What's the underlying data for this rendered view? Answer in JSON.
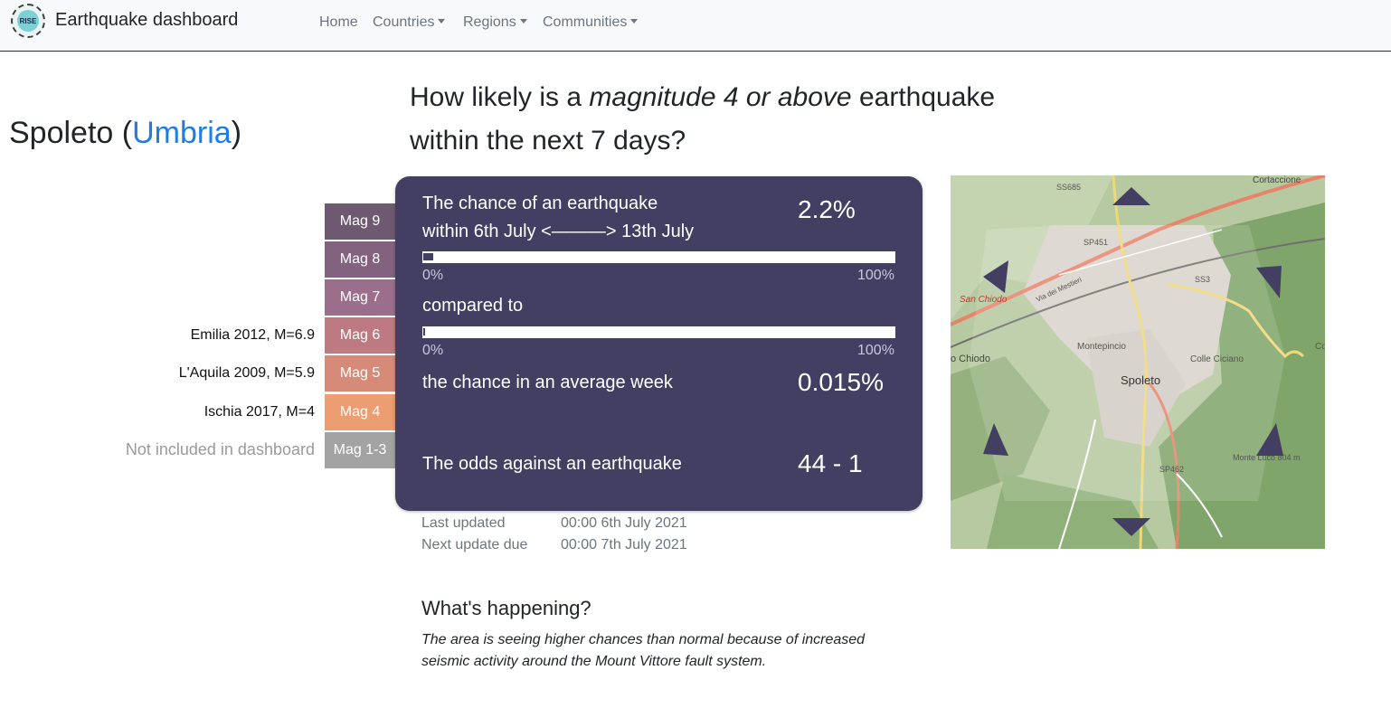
{
  "nav": {
    "logo_text": "RISE",
    "brand": "Earthquake dashboard",
    "items": [
      {
        "label": "Home",
        "dropdown": false
      },
      {
        "label": "Countries",
        "dropdown": true
      },
      {
        "label": "Regions",
        "dropdown": true
      },
      {
        "label": "Communities",
        "dropdown": true
      }
    ]
  },
  "location": {
    "name": "Spoleto",
    "open_paren": "(",
    "region": "Umbria",
    "close_paren": ")"
  },
  "question": {
    "part1": "How likely is a",
    "emphasis": "magnitude 4 or above",
    "part2": "earthquake within the next 7 days?"
  },
  "magnitudes": [
    {
      "label": "Mag 9",
      "color": "#6e5a70",
      "reference": ""
    },
    {
      "label": "Mag 8",
      "color": "#82627f",
      "reference": ""
    },
    {
      "label": "Mag 7",
      "color": "#9b6f8c",
      "reference": ""
    },
    {
      "label": "Mag 6",
      "color": "#bd7b81",
      "reference": "Emilia 2012, M=6.9"
    },
    {
      "label": "Mag 5",
      "color": "#d68b78",
      "reference": "L'Aquila 2009, M=5.9"
    },
    {
      "label": "Mag 4",
      "color": "#ec9d71",
      "reference": "Ischia 2017, M=4"
    },
    {
      "label": "Mag 1-3",
      "color": "#a3a3a3",
      "reference": "Not included in dashboard"
    }
  ],
  "card": {
    "chance_line1": "The chance of an earthquake",
    "chance_line2": "within 6th July <———> 13th July",
    "chance_value": "2.2%",
    "chance_fraction": 0.022,
    "compared_to": "compared to",
    "average_fraction": 0.00015,
    "average_label": "the chance in an average week",
    "average_value": "0.015%",
    "odds_label": "The odds against an earthquake",
    "odds_value": "44 - 1",
    "bar_min": "0%",
    "bar_max": "100%"
  },
  "updates": {
    "last_label": "Last updated",
    "last_value": "00:00 6th July 2021",
    "next_label": "Next update due",
    "next_value": "00:00 7th July 2021"
  },
  "map": {
    "labels": [
      "SS685",
      "Cortaccione",
      "SP451",
      "SS3",
      "San Chiodo",
      "Via dei Mestieri",
      "Montepincio",
      "Colle Ciciano",
      "o Chiodo",
      "Spoleto",
      "SP462",
      "Monte Luco 804 m",
      "Co"
    ],
    "colors": {
      "base": "#b6c9a0",
      "forest": "#7fa56b",
      "urban": "#d6d0c9",
      "road_major": "#e8836b",
      "road_minor": "#f0d878",
      "arrow": "#423f63"
    }
  },
  "happening": {
    "title": "What's happening?",
    "text": "The area is seeing higher chances than normal because of increased seismic activity around the Mount Vittore fault system."
  }
}
